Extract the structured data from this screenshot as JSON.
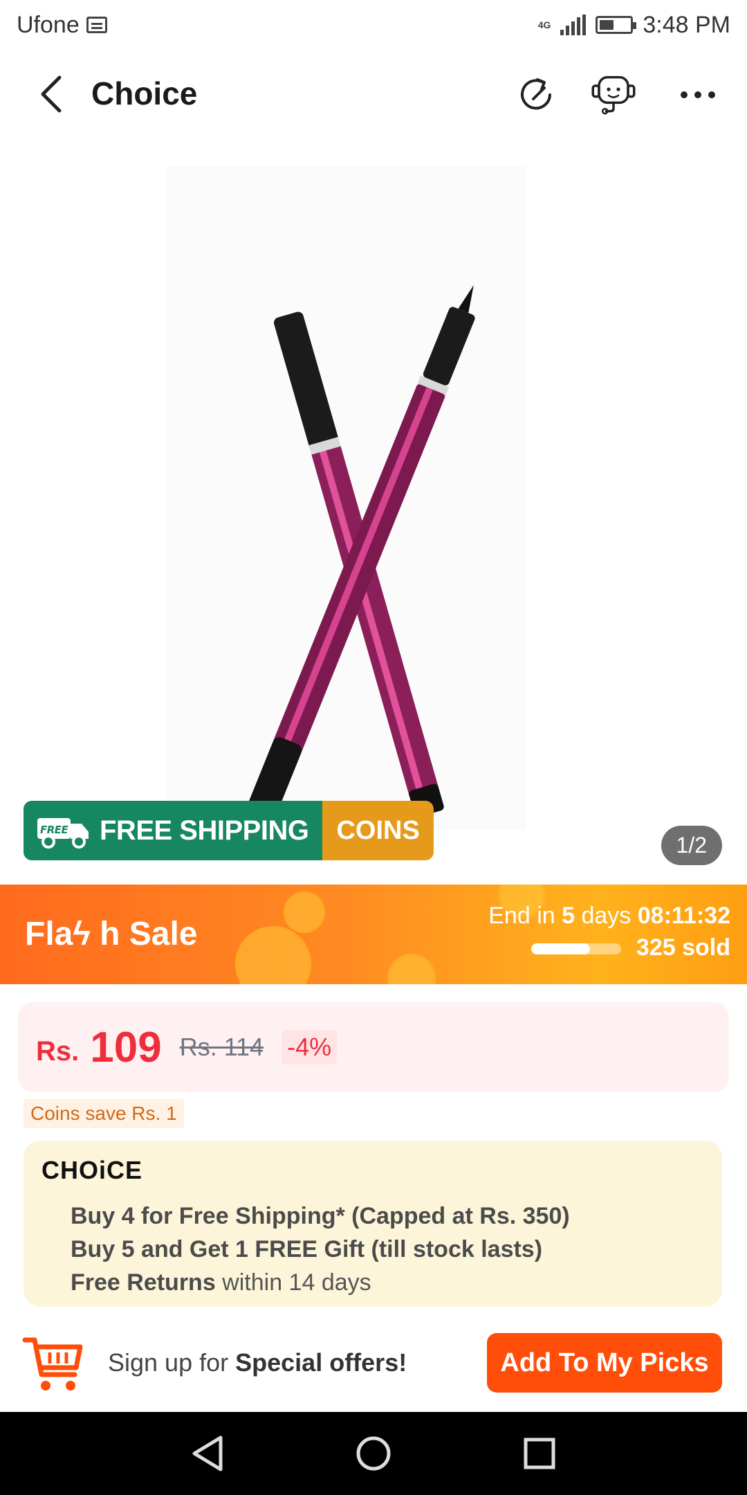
{
  "status_bar": {
    "carrier": "Ufone",
    "network": "4G",
    "time": "3:48 PM"
  },
  "nav": {
    "title": "Choice"
  },
  "product_image": {
    "counter": "1/2",
    "badge_shipping": "FREE SHIPPING",
    "badge_coins": "COINS",
    "truck_label": "FREE"
  },
  "flash_sale": {
    "title": "Flaϟ h  Sale",
    "ends_prefix": "End in",
    "ends_days": "5",
    "ends_days_label": "days",
    "ends_time": "08:11:32",
    "sold": "325 sold",
    "progress": 0.65
  },
  "price": {
    "currency": "Rs.",
    "current": "109",
    "original": "Rs. 114",
    "discount": "-4%"
  },
  "coins_save": "Coins save Rs. 1",
  "choice": {
    "logo": "CHOiCE",
    "line1": "Buy 4 for  Free Shipping* (Capped at Rs. 350)",
    "line2": "Buy 5 and Get 1 FREE Gift (till stock lasts)",
    "line3_bold": "Free Returns",
    "line3_rest": " within 14 days"
  },
  "bottom": {
    "signup_prefix": "Sign up for ",
    "signup_bold": "Special offers!",
    "button": "Add To My Picks"
  },
  "colors": {
    "accent": "#ff4d0a",
    "price_red": "#ee2e3c",
    "shipping_green": "#16875f",
    "coins_orange": "#e69a1b"
  }
}
